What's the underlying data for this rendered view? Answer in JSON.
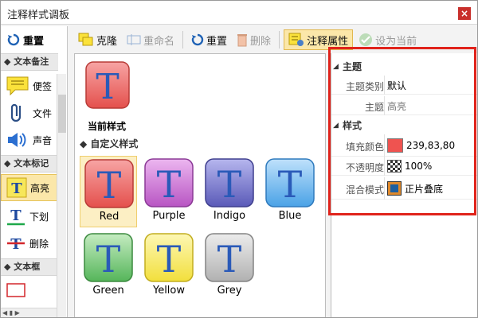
{
  "window": {
    "title": "注释样式调板",
    "close_symbol": "×"
  },
  "left_pane": {
    "reset_label": "重置",
    "groups": [
      "文本备注",
      "文本标记",
      "文本框"
    ],
    "items": [
      {
        "label": "便签",
        "icon": "sticky-note-icon"
      },
      {
        "label": "文件",
        "icon": "paperclip-icon"
      },
      {
        "label": "声音",
        "icon": "speaker-icon"
      },
      {
        "label": "高亮",
        "icon": "highlight-icon",
        "selected": true
      },
      {
        "label": "下划",
        "icon": "underline-icon"
      },
      {
        "label": "删除",
        "icon": "strikethrough-icon"
      }
    ]
  },
  "toolbar": {
    "clone": "克隆",
    "rename": "重命名",
    "reset": "重置",
    "delete": "删除",
    "properties": "注释属性",
    "set_current": "设为当前"
  },
  "styles": {
    "current_label": "当前样式",
    "section_title": "自定义样式",
    "tile_letter": "T",
    "items": [
      {
        "name": "Red",
        "selected": true,
        "top": "#f7a4a4",
        "bottom": "#e4504c",
        "border": "#b83b37"
      },
      {
        "name": "Purple",
        "top": "#ecb6f0",
        "bottom": "#b855c3",
        "border": "#8b3a96"
      },
      {
        "name": "Indigo",
        "top": "#b6b6ee",
        "bottom": "#5a5ab8",
        "border": "#3f3f8e"
      },
      {
        "name": "Blue",
        "top": "#bfe1fb",
        "bottom": "#4aa2e6",
        "border": "#2f7abd"
      },
      {
        "name": "Green",
        "top": "#c5ecc1",
        "bottom": "#55b55a",
        "border": "#3b8a3f"
      },
      {
        "name": "Yellow",
        "top": "#fdf7b4",
        "bottom": "#f2df3c",
        "border": "#c2ad1f"
      },
      {
        "name": "Grey",
        "top": "#ececec",
        "bottom": "#b1b1b1",
        "border": "#838383"
      }
    ],
    "letter_color": "#2a5ab8"
  },
  "properties": {
    "theme_group": "主题",
    "theme_type_key": "主题类别",
    "theme_type_value": "默认",
    "theme_key": "主题",
    "theme_value": "高亮",
    "style_group": "样式",
    "fill_key": "填充颜色",
    "fill_value": "239,83,80",
    "fill_color": "#ef5350",
    "opacity_key": "不透明度",
    "opacity_value": "100%",
    "blend_key": "混合模式",
    "blend_value": "正片叠底"
  }
}
